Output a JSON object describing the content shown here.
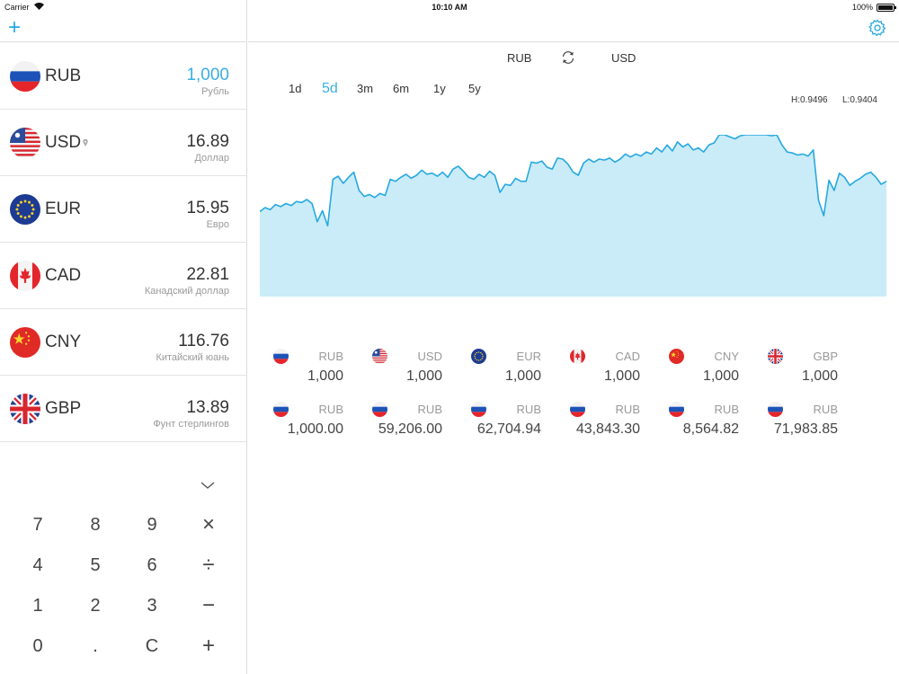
{
  "status_bar": {
    "carrier": "Carrier",
    "time": "10:10 AM",
    "battery": "100%"
  },
  "toolbar": {
    "add_label": "+"
  },
  "currencies": [
    {
      "code": "RUB",
      "value": "1,000",
      "name": "Рубль",
      "active": true,
      "flag": "ru"
    },
    {
      "code": "USD",
      "value": "16.89",
      "name": "Доллар",
      "active": false,
      "flag": "us",
      "pin": true
    },
    {
      "code": "EUR",
      "value": "15.95",
      "name": "Евро",
      "active": false,
      "flag": "eu"
    },
    {
      "code": "CAD",
      "value": "22.81",
      "name": "Канадский доллар",
      "active": false,
      "flag": "ca"
    },
    {
      "code": "CNY",
      "value": "116.76",
      "name": "Китайский юань",
      "active": false,
      "flag": "cn"
    },
    {
      "code": "GBP",
      "value": "13.89",
      "name": "Фунт стерлингов",
      "active": false,
      "flag": "gb"
    }
  ],
  "keypad": {
    "keys": [
      "7",
      "8",
      "9",
      "×",
      "4",
      "5",
      "6",
      "÷",
      "1",
      "2",
      "3",
      "−",
      "0",
      ".",
      "C",
      "+"
    ]
  },
  "pair": {
    "from": "RUB",
    "to": "USD"
  },
  "periods": [
    "1d",
    "5d",
    "3m",
    "6m",
    "1y",
    "5y"
  ],
  "active_period": "5d",
  "hilo": {
    "high": "H:0.9496",
    "low": "L:0.9404"
  },
  "colors": {
    "accent": "#3aaee2",
    "chart_line": "#27a8e0",
    "chart_fill": "#c9ecf8"
  },
  "chart_data": {
    "type": "area",
    "title": "",
    "xlabel": "",
    "ylabel": "",
    "ylim": [
      0.936,
      0.952
    ],
    "grid": false,
    "values": [
      0.9444,
      0.9448,
      0.9446,
      0.9451,
      0.9449,
      0.9452,
      0.945,
      0.9454,
      0.9453,
      0.9456,
      0.9452,
      0.9434,
      0.9445,
      0.943,
      0.9476,
      0.9479,
      0.9472,
      0.9478,
      0.9483,
      0.9465,
      0.9459,
      0.9461,
      0.9458,
      0.9462,
      0.946,
      0.9476,
      0.9474,
      0.9478,
      0.9481,
      0.9477,
      0.948,
      0.9485,
      0.9481,
      0.9482,
      0.9479,
      0.9483,
      0.9478,
      0.9486,
      0.9489,
      0.9484,
      0.9478,
      0.9476,
      0.9481,
      0.9478,
      0.9484,
      0.948,
      0.9463,
      0.9471,
      0.947,
      0.9477,
      0.9474,
      0.9474,
      0.9493,
      0.9492,
      0.9494,
      0.9488,
      0.9486,
      0.9497,
      0.9496,
      0.9491,
      0.9483,
      0.948,
      0.9492,
      0.9496,
      0.9493,
      0.9496,
      0.9495,
      0.9497,
      0.9493,
      0.9496,
      0.9501,
      0.9498,
      0.9501,
      0.9499,
      0.9503,
      0.9501,
      0.9507,
      0.9503,
      0.951,
      0.9504,
      0.9513,
      0.9508,
      0.9511,
      0.9505,
      0.9507,
      0.9503,
      0.951,
      0.9512,
      0.952,
      0.952,
      0.9518,
      0.9516,
      0.9519,
      0.9521,
      0.9522,
      0.9523,
      0.9522,
      0.9523,
      0.9519,
      0.9522,
      0.951,
      0.9503,
      0.9502,
      0.95,
      0.9501,
      0.9499,
      0.9505,
      0.9455,
      0.944,
      0.9475,
      0.9465,
      0.9482,
      0.9478,
      0.947,
      0.9474,
      0.9477,
      0.9481,
      0.9483,
      0.9478,
      0.9471,
      0.9474
    ]
  },
  "conversions": {
    "top": [
      {
        "code": "RUB",
        "value": "1,000",
        "flag": "ru"
      },
      {
        "code": "USD",
        "value": "1,000",
        "flag": "us"
      },
      {
        "code": "EUR",
        "value": "1,000",
        "flag": "eu"
      },
      {
        "code": "CAD",
        "value": "1,000",
        "flag": "ca"
      },
      {
        "code": "CNY",
        "value": "1,000",
        "flag": "cn"
      },
      {
        "code": "GBP",
        "value": "1,000",
        "flag": "gb"
      }
    ],
    "bottom": [
      {
        "code": "RUB",
        "value": "1,000.00",
        "flag": "ru"
      },
      {
        "code": "RUB",
        "value": "59,206.00",
        "flag": "ru"
      },
      {
        "code": "RUB",
        "value": "62,704.94",
        "flag": "ru"
      },
      {
        "code": "RUB",
        "value": "43,843.30",
        "flag": "ru"
      },
      {
        "code": "RUB",
        "value": "8,564.82",
        "flag": "ru"
      },
      {
        "code": "RUB",
        "value": "71,983.85",
        "flag": "ru"
      }
    ]
  }
}
